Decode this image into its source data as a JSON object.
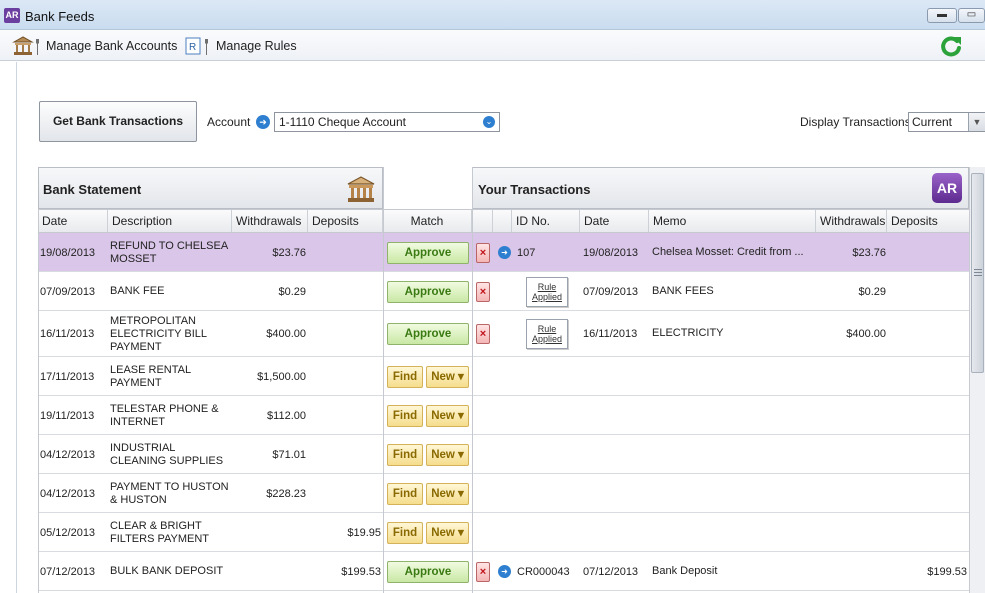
{
  "window": {
    "app_icon_text": "AR",
    "title": "Bank Feeds",
    "minimize_glyph": "▬",
    "maximize_glyph": "▭"
  },
  "toolbar": {
    "manage_bank_accounts": "Manage Bank Accounts",
    "manage_rules": "Manage Rules"
  },
  "controls": {
    "get_transactions": "Get Bank Transactions",
    "account_label": "Account",
    "account_value": "1-1110 Cheque Account",
    "display_label": "Display Transactions:",
    "display_value": "Current"
  },
  "bank_statement": {
    "title": "Bank Statement",
    "columns": {
      "date": "Date",
      "description": "Description",
      "withdrawals": "Withdrawals",
      "deposits": "Deposits"
    }
  },
  "match_header": "Match",
  "your_transactions": {
    "title": "Your Transactions",
    "badge": "AR",
    "columns": {
      "id": "ID No.",
      "date": "Date",
      "memo": "Memo",
      "withdrawals": "Withdrawals",
      "deposits": "Deposits"
    }
  },
  "buttons": {
    "approve": "Approve",
    "find": "Find",
    "new": "New ▾",
    "reject": "×",
    "go": "➜",
    "rule_line1": "Rule",
    "rule_line2": "Applied"
  },
  "rows": [
    {
      "date": "19/08/2013",
      "description": "REFUND TO CHELSEA MOSSET",
      "withdrawals": "$23.76",
      "deposits": "",
      "action": "approve",
      "match_kind": "go",
      "id": "107",
      "your_date": "19/08/2013",
      "memo": "Chelsea Mosset:  Credit from ...",
      "your_withdrawals": "$23.76",
      "your_deposits": ""
    },
    {
      "date": "07/09/2013",
      "description": "BANK FEE",
      "withdrawals": "$0.29",
      "deposits": "",
      "action": "approve",
      "match_kind": "rule",
      "id": "",
      "your_date": "07/09/2013",
      "memo": "BANK FEES",
      "your_withdrawals": "$0.29",
      "your_deposits": ""
    },
    {
      "date": "16/11/2013",
      "description": "METROPOLITAN ELECTRICITY BILL PAYMENT",
      "withdrawals": "$400.00",
      "deposits": "",
      "action": "approve",
      "match_kind": "rule",
      "id": "",
      "your_date": "16/11/2013",
      "memo": "ELECTRICITY",
      "your_withdrawals": "$400.00",
      "your_deposits": ""
    },
    {
      "date": "17/11/2013",
      "description": "LEASE RENTAL PAYMENT",
      "withdrawals": "$1,500.00",
      "deposits": "",
      "action": "find_new"
    },
    {
      "date": "19/11/2013",
      "description": "TELESTAR PHONE & INTERNET",
      "withdrawals": "$112.00",
      "deposits": "",
      "action": "find_new"
    },
    {
      "date": "04/12/2013",
      "description": "INDUSTRIAL CLEANING SUPPLIES",
      "withdrawals": "$71.01",
      "deposits": "",
      "action": "find_new"
    },
    {
      "date": "04/12/2013",
      "description": "PAYMENT TO HUSTON & HUSTON",
      "withdrawals": "$228.23",
      "deposits": "",
      "action": "find_new"
    },
    {
      "date": "05/12/2013",
      "description": "CLEAR & BRIGHT FILTERS PAYMENT",
      "withdrawals": "",
      "deposits": "$19.95",
      "action": "find_new"
    },
    {
      "date": "07/12/2013",
      "description": "BULK BANK DEPOSIT",
      "withdrawals": "",
      "deposits": "$199.53",
      "action": "approve",
      "match_kind": "go",
      "id": "CR000043",
      "your_date": "07/12/2013",
      "memo": "Bank Deposit",
      "your_withdrawals": "",
      "your_deposits": "$199.53"
    }
  ],
  "colors": {
    "highlight_row": "#d9c6e8",
    "approve_text": "#3a7a12",
    "find_text": "#8a6a00",
    "reject": "#c0121a",
    "accent_blue": "#2f7fd0"
  }
}
